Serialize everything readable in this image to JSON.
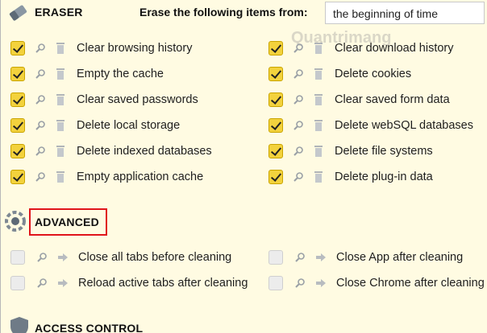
{
  "eraser": {
    "title": "ERASER",
    "erase_label": "Erase the following items from:",
    "time_range": "the beginning of time",
    "items": [
      {
        "label": "Clear browsing history",
        "checked": true
      },
      {
        "label": "Empty the cache",
        "checked": true
      },
      {
        "label": "Clear saved passwords",
        "checked": true
      },
      {
        "label": "Delete local storage",
        "checked": true
      },
      {
        "label": "Delete indexed databases",
        "checked": true
      },
      {
        "label": "Empty application cache",
        "checked": true
      },
      {
        "label": "Clear download history",
        "checked": true
      },
      {
        "label": "Delete cookies",
        "checked": true
      },
      {
        "label": "Clear saved form data",
        "checked": true
      },
      {
        "label": "Delete webSQL databases",
        "checked": true
      },
      {
        "label": "Delete file systems",
        "checked": true
      },
      {
        "label": "Delete plug-in data",
        "checked": true
      }
    ]
  },
  "advanced": {
    "title": "ADVANCED",
    "items": [
      {
        "label": "Close all tabs before cleaning",
        "checked": false
      },
      {
        "label": "Reload active tabs after cleaning",
        "checked": false
      },
      {
        "label": "Close App after cleaning",
        "checked": false
      },
      {
        "label": "Close Chrome after cleaning",
        "checked": false
      }
    ]
  },
  "access_control": {
    "title": "ACCESS CONTROL"
  },
  "watermark": "Quantrimang",
  "colors": {
    "background": "#fffbe2",
    "checkbox_checked": "#f3d23d",
    "highlight_border": "#e0141b"
  }
}
